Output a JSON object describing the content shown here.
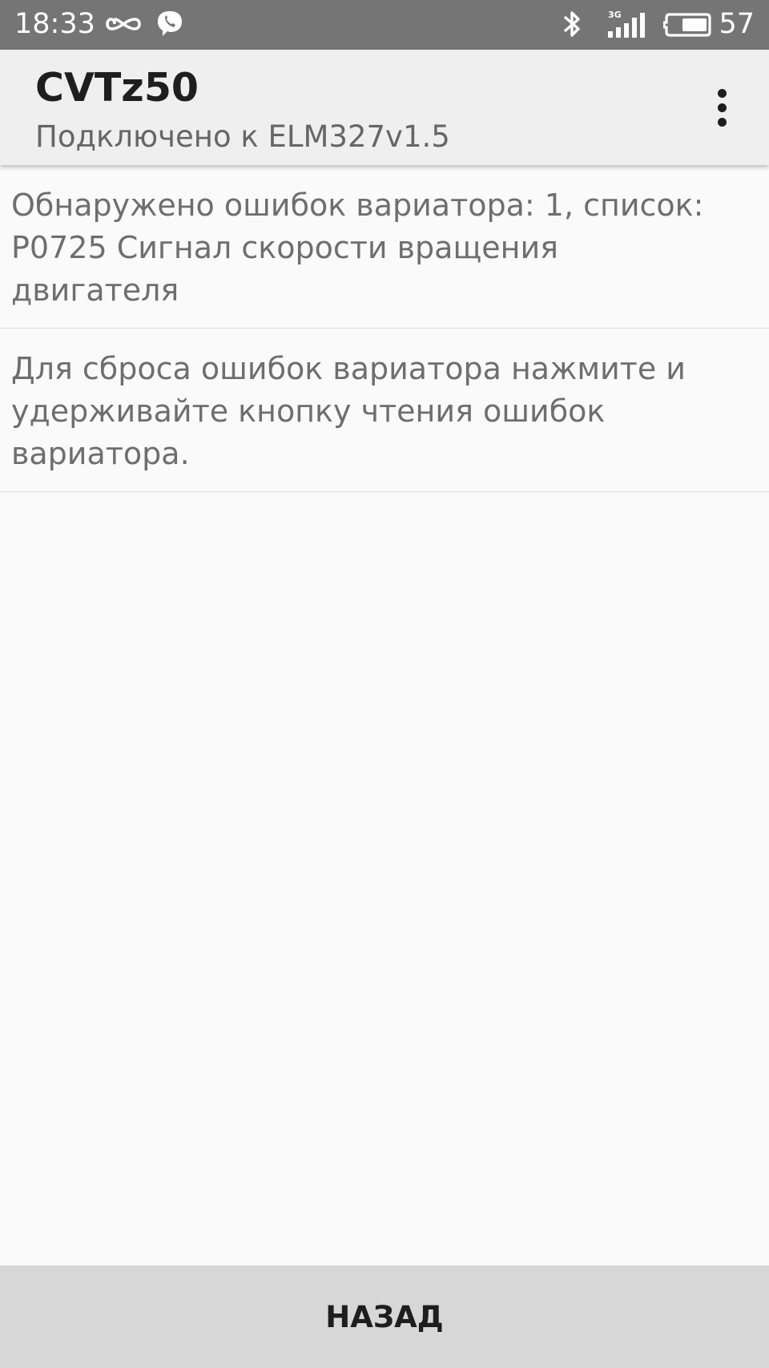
{
  "status_bar": {
    "time": "18:33",
    "battery_percent": "57",
    "icons": [
      "infinity-icon",
      "viber-icon",
      "bluetooth-icon",
      "signal-3g-icon",
      "battery-icon"
    ],
    "network_label": "3G"
  },
  "app_bar": {
    "title": "CVTz50",
    "subtitle": "Подключено к ELM327v1.5",
    "overflow_icon": "more-vert-icon"
  },
  "messages": [
    {
      "lines": [
        "Обнаружено ошибок вариатора: 1, список:",
        "P0725 Сигнал скорости вращения",
        "двигателя"
      ]
    },
    {
      "lines": [
        "Для сброса ошибок вариатора нажмите и",
        "удерживайте кнопку чтения ошибок",
        "вариатора."
      ]
    }
  ],
  "footer": {
    "back_label": "НАЗАД"
  },
  "colors": {
    "status_bar_bg": "#757575",
    "app_bar_bg": "#efefef",
    "page_bg": "#fafafa",
    "footer_bg": "#d6d7d6",
    "body_text": "#6e6e6e",
    "title_text": "#1e1e1e"
  }
}
